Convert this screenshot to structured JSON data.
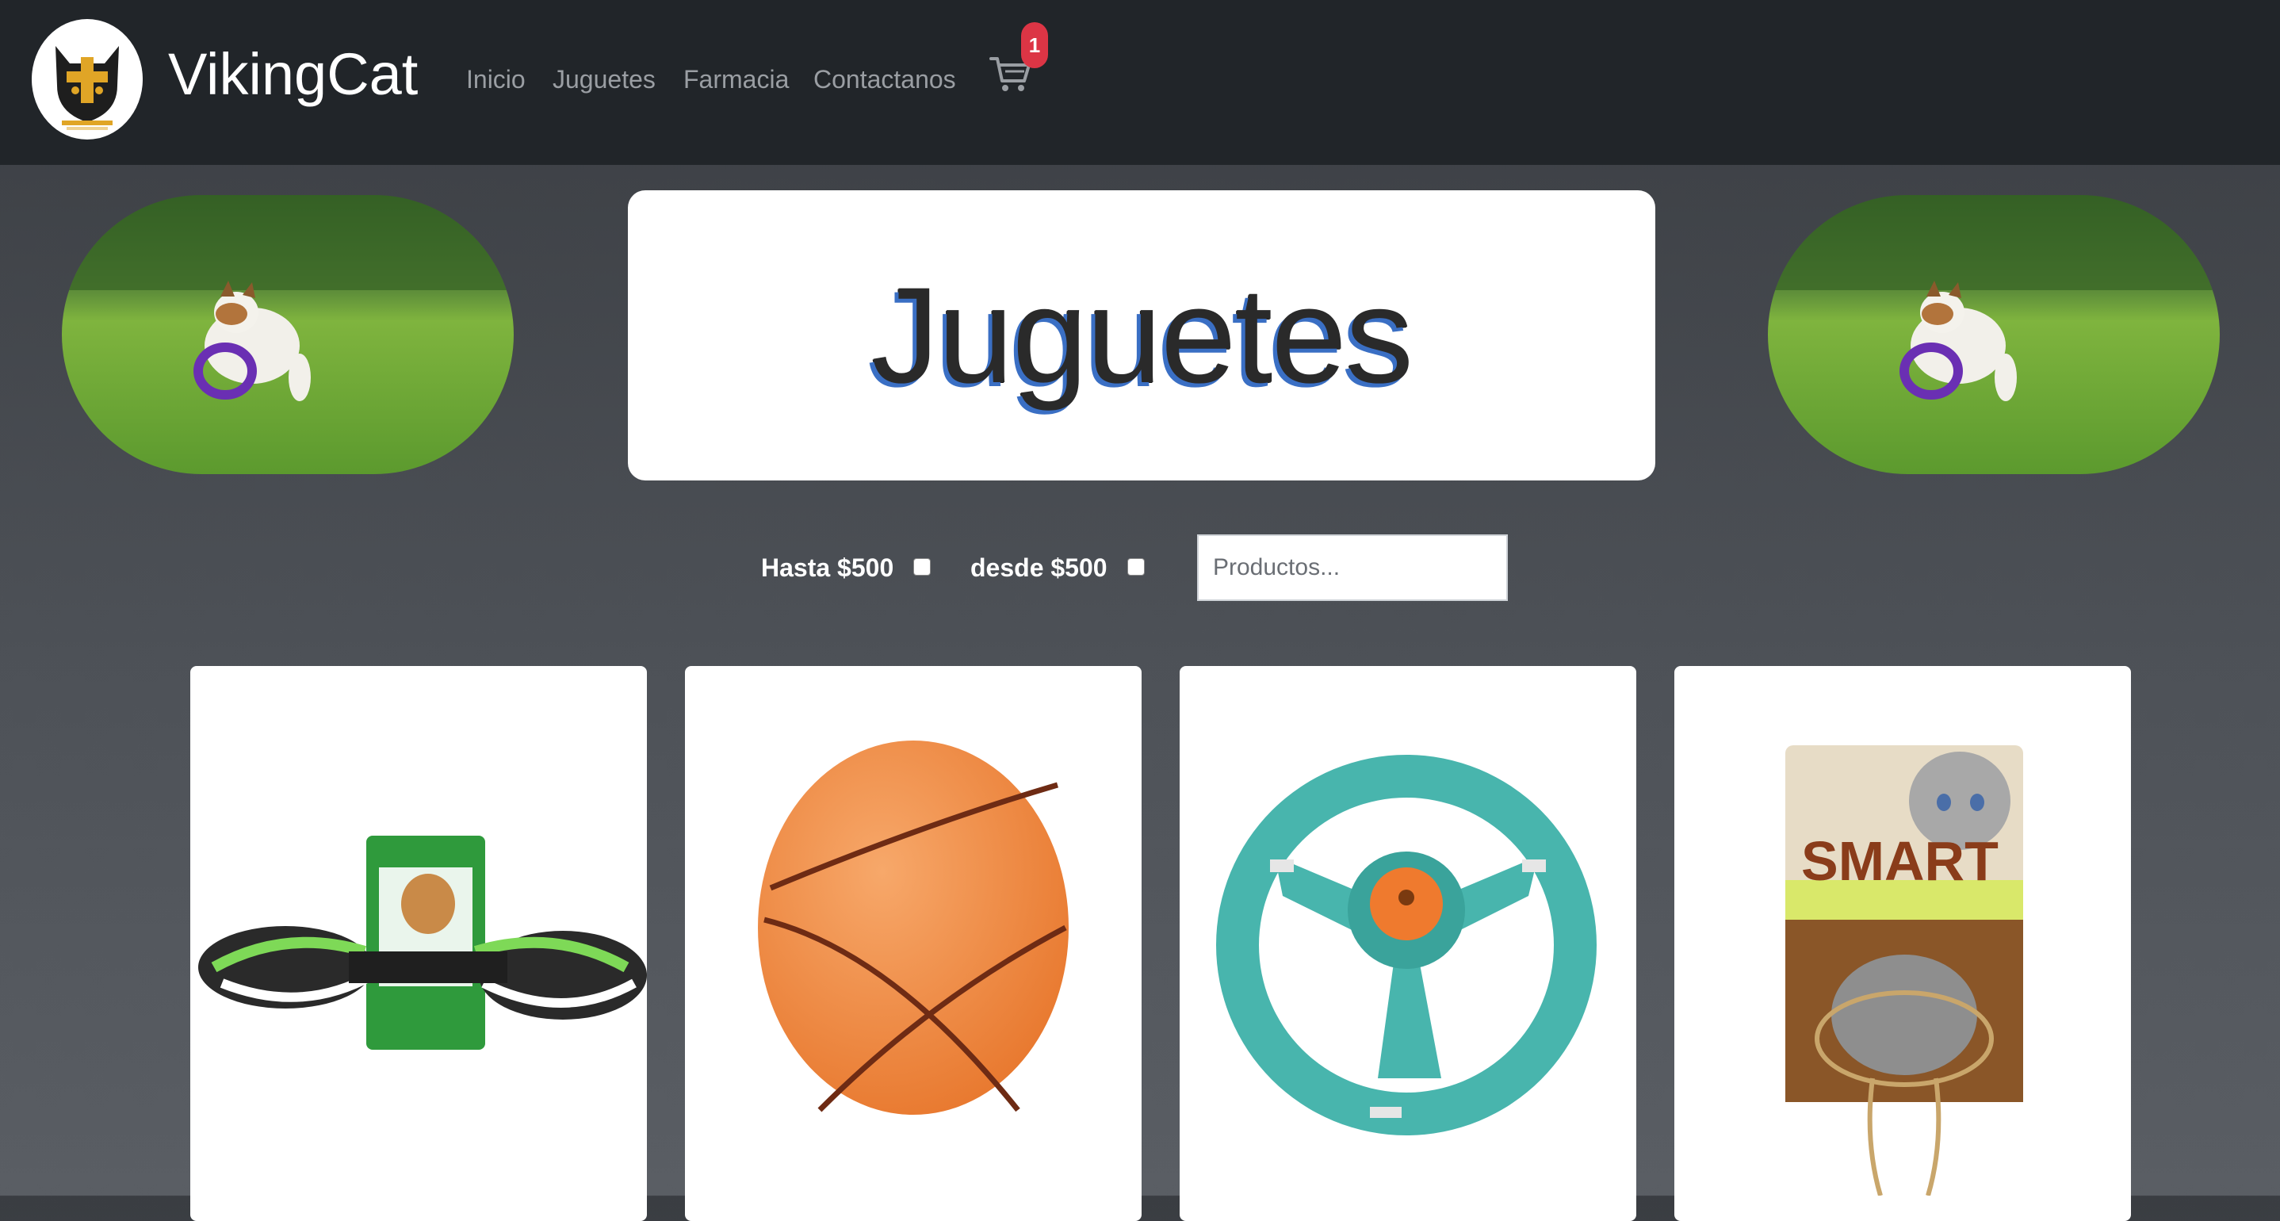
{
  "header": {
    "brand": "VikingCat",
    "logo_icon": "viking-cat-logo",
    "nav": [
      {
        "label": "Inicio"
      },
      {
        "label": "Juguetes"
      },
      {
        "label": "Farmacia"
      },
      {
        "label": "Contactanos"
      }
    ],
    "cart": {
      "icon": "cart-icon",
      "count": "1",
      "badge_color": "#dc3545"
    }
  },
  "hero": {
    "title": "Juguetes",
    "side_image": "dog-with-ring-toy"
  },
  "filters": {
    "max_label": "Hasta $500",
    "min_label": "desde $500",
    "max_checked": false,
    "min_checked": false,
    "search_placeholder": "Productos...",
    "search_value": ""
  },
  "products": [
    {
      "image": "rope-toy"
    },
    {
      "image": "basketball-toy"
    },
    {
      "image": "ring-frisbee-toy"
    },
    {
      "image": "smart-mouse-toy"
    }
  ],
  "colors": {
    "navbar": "#212529",
    "nav_link": "#9a9ea3",
    "title_shadow": "#3a6fc4"
  }
}
